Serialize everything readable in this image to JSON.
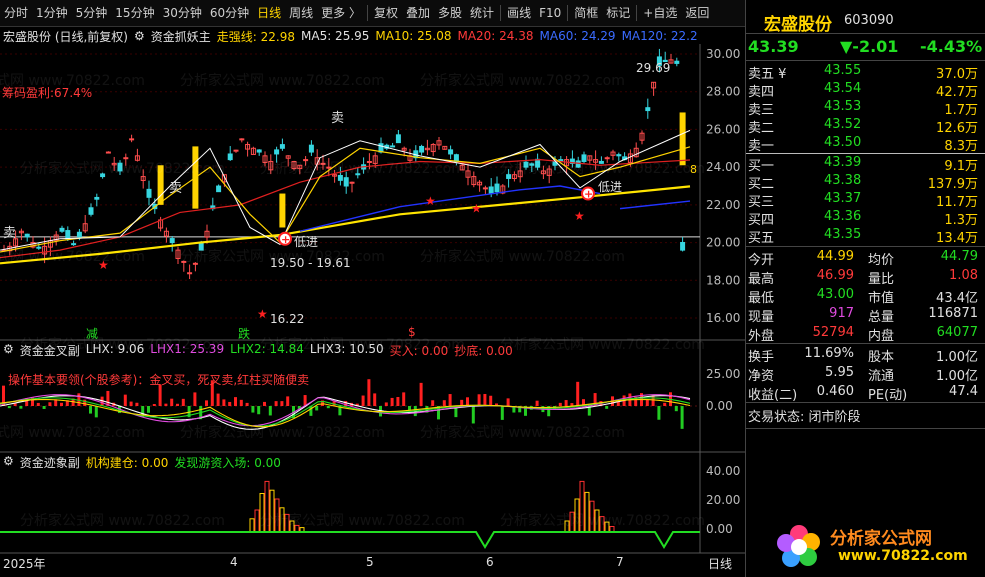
{
  "toolbar": {
    "items": [
      "分时",
      "1分钟",
      "5分钟",
      "15分钟",
      "30分钟",
      "60分钟",
      "日线",
      "周线",
      "更多 〉",
      "复权",
      "叠加",
      "多股",
      "统计",
      "画线",
      "F10",
      "简框",
      "标记",
      "+自选",
      "返回"
    ],
    "active_index": 6
  },
  "info_bar": {
    "stock_label": "宏盛股份 (日线,前复权)",
    "indicator_name": "资金抓妖主",
    "strong_line": "走强线: 22.98",
    "ma5": "MA5: 25.95",
    "ma10": "MA10: 25.08",
    "ma20": "MA20: 24.38",
    "ma60": "MA60: 24.29",
    "ma120": "MA120: 22.2"
  },
  "main_chart": {
    "chip_profit": "筹码盈利:67.4%",
    "price_axis": [
      "30.00",
      "28.00",
      "26.00",
      "24.00",
      "22.00",
      "20.00",
      "18.00",
      "16.00"
    ],
    "high_label": "29.69",
    "low_label": "16.22",
    "range_label": "19.50 - 19.61",
    "sell_labels": [
      "卖",
      "卖",
      "卖"
    ],
    "buy_labels": [
      "低进",
      "低进"
    ],
    "bottom_markers": [
      "减",
      "跌",
      "$"
    ],
    "right_edge_label": "8"
  },
  "panel2": {
    "title": "资金金叉副",
    "lhx": "LHX: 9.06",
    "lhx1": "LHX1: 25.39",
    "lhx2": "LHX2: 14.84",
    "lhx3": "LHX3: 10.50",
    "buy": "买入: 0.00",
    "bottom": "抄底: 0.00",
    "note": "操作基本要领(个股参考)：金叉买，死叉卖,红柱买随便卖",
    "axis": [
      "25.00",
      "0.00"
    ]
  },
  "panel3": {
    "title": "资金迹象副",
    "inst_build": "机构建仓: 0.00",
    "hot_money": "发现游资入场: 0.00",
    "axis": [
      "40.00",
      "20.00",
      "0.00"
    ]
  },
  "time_axis": {
    "labels": [
      "2025年",
      "4",
      "5",
      "6",
      "7"
    ],
    "period": "日线"
  },
  "quote": {
    "name": "宏盛股份",
    "code": "603090",
    "price": "43.39",
    "change": "▼-2.01",
    "change_pct": "-4.43%",
    "asks": [
      {
        "label": "卖五 ¥",
        "price": "43.55",
        "vol": "37.0万"
      },
      {
        "label": "卖四",
        "price": "43.54",
        "vol": "42.7万"
      },
      {
        "label": "卖三",
        "price": "43.53",
        "vol": "1.7万"
      },
      {
        "label": "卖二",
        "price": "43.52",
        "vol": "12.6万"
      },
      {
        "label": "卖一",
        "price": "43.50",
        "vol": "8.3万"
      }
    ],
    "bids": [
      {
        "label": "买一",
        "price": "43.39",
        "vol": "9.1万"
      },
      {
        "label": "买二",
        "price": "43.38",
        "vol": "137.9万"
      },
      {
        "label": "买三",
        "price": "43.37",
        "vol": "11.7万"
      },
      {
        "label": "买四",
        "price": "43.36",
        "vol": "1.3万"
      },
      {
        "label": "买五",
        "price": "43.35",
        "vol": "13.4万"
      }
    ],
    "stats": [
      {
        "l1": "今开",
        "v1": "44.99",
        "l2": "均价",
        "v2": "44.79"
      },
      {
        "l1": "最高",
        "v1": "46.99",
        "l2": "量比",
        "v2": "1.08"
      },
      {
        "l1": "最低",
        "v1": "43.00",
        "l2": "市值",
        "v2": "43.4亿"
      },
      {
        "l1": "现量",
        "v1": "917",
        "l2": "总量",
        "v2": "116871"
      },
      {
        "l1": "外盘",
        "v1": "52794",
        "l2": "内盘",
        "v2": "64077"
      }
    ],
    "stats2": [
      {
        "l1": "换手",
        "v1": "11.69%",
        "l2": "股本",
        "v2": "1.00亿"
      },
      {
        "l1": "净资",
        "v1": "5.95",
        "l2": "流通",
        "v2": "1.00亿"
      },
      {
        "l1": "收益(二)",
        "v1": "0.460",
        "l2": "PE(动)",
        "v2": "47.4"
      }
    ],
    "trade_status": "交易状态: 闭市阶段"
  },
  "logo": {
    "title": "分析家公式网",
    "url": "www.70822.com"
  },
  "watermark": "分析家公式网 www.70822.com"
}
